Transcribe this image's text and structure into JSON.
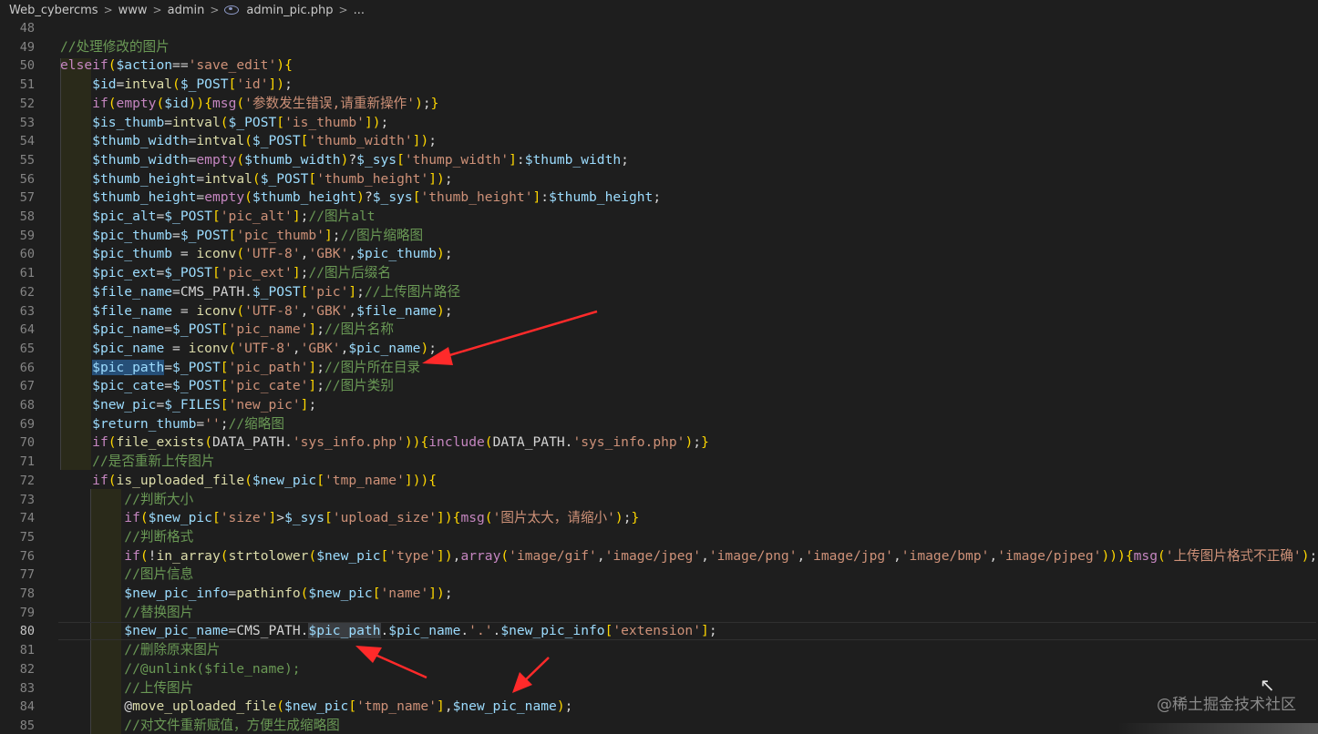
{
  "breadcrumb": {
    "segments": [
      "Web_cybercms",
      "www",
      "admin",
      "admin_pic.php",
      "..."
    ],
    "separator": ">",
    "file_icon": "php-file-icon"
  },
  "editor": {
    "active_line": "80",
    "lines": [
      {
        "n": "48",
        "text": ""
      },
      {
        "n": "49",
        "text": "//处理修改的图片"
      },
      {
        "n": "50",
        "text": "elseif($action=='save_edit'){"
      },
      {
        "n": "51",
        "text": "    $id=intval($_POST['id']);"
      },
      {
        "n": "52",
        "text": "    if(empty($id)){msg('参数发生错误,请重新操作');}"
      },
      {
        "n": "53",
        "text": "    $is_thumb=intval($_POST['is_thumb']);"
      },
      {
        "n": "54",
        "text": "    $thumb_width=intval($_POST['thumb_width']);"
      },
      {
        "n": "55",
        "text": "    $thumb_width=empty($thumb_width)?$_sys['thump_width']:$thumb_width;"
      },
      {
        "n": "56",
        "text": "    $thumb_height=intval($_POST['thumb_height']);"
      },
      {
        "n": "57",
        "text": "    $thumb_height=empty($thumb_height)?$_sys['thumb_height']:$thumb_height;"
      },
      {
        "n": "58",
        "text": "    $pic_alt=$_POST['pic_alt'];//图片alt"
      },
      {
        "n": "59",
        "text": "    $pic_thumb=$_POST['pic_thumb'];//图片缩略图"
      },
      {
        "n": "60",
        "text": "    $pic_thumb = iconv('UTF-8','GBK',$pic_thumb);"
      },
      {
        "n": "61",
        "text": "    $pic_ext=$_POST['pic_ext'];//图片后缀名"
      },
      {
        "n": "62",
        "text": "    $file_name=CMS_PATH.$_POST['pic'];//上传图片路径"
      },
      {
        "n": "63",
        "text": "    $file_name = iconv('UTF-8','GBK',$file_name);"
      },
      {
        "n": "64",
        "text": "    $pic_name=$_POST['pic_name'];//图片名称"
      },
      {
        "n": "65",
        "text": "    $pic_name = iconv('UTF-8','GBK',$pic_name);"
      },
      {
        "n": "66",
        "text": "    $pic_path=$_POST['pic_path'];//图片所在目录"
      },
      {
        "n": "67",
        "text": "    $pic_cate=$_POST['pic_cate'];//图片类别"
      },
      {
        "n": "68",
        "text": "    $new_pic=$_FILES['new_pic'];"
      },
      {
        "n": "69",
        "text": "    $return_thumb='';//缩略图"
      },
      {
        "n": "70",
        "text": "    if(file_exists(DATA_PATH.'sys_info.php')){include(DATA_PATH.'sys_info.php');}"
      },
      {
        "n": "71",
        "text": "    //是否重新上传图片"
      },
      {
        "n": "72",
        "text": "    if(is_uploaded_file($new_pic['tmp_name'])){"
      },
      {
        "n": "73",
        "text": "        //判断大小"
      },
      {
        "n": "74",
        "text": "        if($new_pic['size']>$_sys['upload_size']){msg('图片太大，请缩小');}"
      },
      {
        "n": "75",
        "text": "        //判断格式"
      },
      {
        "n": "76",
        "text": "        if(!in_array(strtolower($new_pic['type']),array('image/gif','image/jpeg','image/png','image/jpg','image/bmp','image/pjpeg'))){msg('上传图片格式不正确');}"
      },
      {
        "n": "77",
        "text": "        //图片信息"
      },
      {
        "n": "78",
        "text": "        $new_pic_info=pathinfo($new_pic['name']);"
      },
      {
        "n": "79",
        "text": "        //替换图片"
      },
      {
        "n": "80",
        "text": "        $new_pic_name=CMS_PATH.$pic_path.$pic_name.'.'.$new_pic_info['extension'];"
      },
      {
        "n": "81",
        "text": "        //删除原来图片"
      },
      {
        "n": "82",
        "text": "        //@unlink($file_name);"
      },
      {
        "n": "83",
        "text": "        //上传图片"
      },
      {
        "n": "84",
        "text": "        @move_uploaded_file($new_pic['tmp_name'],$new_pic_name);"
      },
      {
        "n": "85",
        "text": "        //对文件重新赋值，方便生成缩略图"
      }
    ]
  },
  "watermark": "@稀土掘金技术社区",
  "colors": {
    "background": "#1e1e1e",
    "keyword": "#c586c0",
    "variable": "#9cdcfe",
    "function": "#dcdcaa",
    "string": "#ce9178",
    "comment": "#6a9955",
    "annotation_arrow": "#ff2a2a"
  }
}
